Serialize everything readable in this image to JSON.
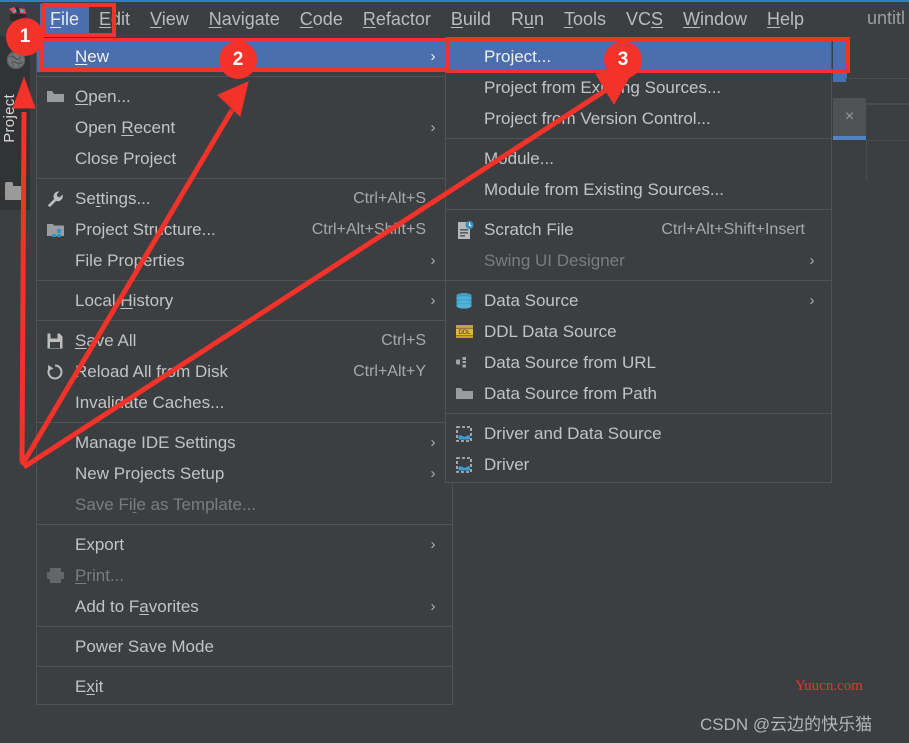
{
  "window": {
    "title": "untitl",
    "accent_color": "#2F7CC7",
    "menu_bg": "#3C3F41",
    "highlight_blue": "#4B6EAF",
    "annotation_red": "#F33229"
  },
  "menubar": {
    "logo_name": "intellij-idea-logo",
    "items": [
      {
        "label": "File",
        "mnemonic": "F",
        "active": true
      },
      {
        "label": "Edit",
        "mnemonic": "E",
        "active": false
      },
      {
        "label": "View",
        "mnemonic": "V",
        "active": false
      },
      {
        "label": "Navigate",
        "mnemonic": "N",
        "active": false
      },
      {
        "label": "Code",
        "mnemonic": "C",
        "active": false
      },
      {
        "label": "Refactor",
        "mnemonic": "R",
        "active": false
      },
      {
        "label": "Build",
        "mnemonic": "B",
        "active": false
      },
      {
        "label": "Run",
        "mnemonic": "u",
        "active": false
      },
      {
        "label": "Tools",
        "mnemonic": "T",
        "active": false
      },
      {
        "label": "VCS",
        "mnemonic": "S",
        "active": false
      },
      {
        "label": "Window",
        "mnemonic": "W",
        "active": false
      },
      {
        "label": "Help",
        "mnemonic": "H",
        "active": false
      }
    ]
  },
  "sidebar": {
    "globe_icon": "globe-icon",
    "project_tab_label": "Project",
    "folder_icon": "folder-icon"
  },
  "file_menu": {
    "items": [
      {
        "label": "New",
        "mnemonic": "N",
        "icon": null,
        "accel": "",
        "arrow": true,
        "selected": true,
        "disabled": false
      },
      {
        "type": "separator"
      },
      {
        "label": "Open...",
        "mnemonic": "O",
        "icon": "open-folder-icon",
        "accel": "",
        "arrow": false,
        "selected": false,
        "disabled": false
      },
      {
        "label": "Open Recent",
        "mnemonic": "R",
        "icon": null,
        "accel": "",
        "arrow": true,
        "selected": false,
        "disabled": false
      },
      {
        "label": "Close Project",
        "mnemonic": "",
        "icon": null,
        "accel": "",
        "arrow": false,
        "selected": false,
        "disabled": false
      },
      {
        "type": "separator"
      },
      {
        "label": "Settings...",
        "mnemonic": "t",
        "icon": "wrench-icon",
        "accel": "Ctrl+Alt+S",
        "arrow": false,
        "selected": false,
        "disabled": false
      },
      {
        "label": "Project Structure...",
        "mnemonic": "",
        "icon": "project-structure-icon",
        "accel": "Ctrl+Alt+Shift+S",
        "arrow": false,
        "selected": false,
        "disabled": false
      },
      {
        "label": "File Properties",
        "mnemonic": "",
        "icon": null,
        "accel": "",
        "arrow": true,
        "selected": false,
        "disabled": false
      },
      {
        "type": "separator"
      },
      {
        "label": "Local History",
        "mnemonic": "H",
        "icon": null,
        "accel": "",
        "arrow": true,
        "selected": false,
        "disabled": false
      },
      {
        "type": "separator"
      },
      {
        "label": "Save All",
        "mnemonic": "S",
        "icon": "save-icon",
        "accel": "Ctrl+S",
        "arrow": false,
        "selected": false,
        "disabled": false
      },
      {
        "label": "Reload All from Disk",
        "mnemonic": "",
        "icon": "reload-icon",
        "accel": "Ctrl+Alt+Y",
        "arrow": false,
        "selected": false,
        "disabled": false
      },
      {
        "label": "Invalidate Caches...",
        "mnemonic": "",
        "icon": null,
        "accel": "",
        "arrow": false,
        "selected": false,
        "disabled": false
      },
      {
        "type": "separator"
      },
      {
        "label": "Manage IDE Settings",
        "mnemonic": "",
        "icon": null,
        "accel": "",
        "arrow": true,
        "selected": false,
        "disabled": false
      },
      {
        "label": "New Projects Setup",
        "mnemonic": "",
        "icon": null,
        "accel": "",
        "arrow": true,
        "selected": false,
        "disabled": false
      },
      {
        "label": "Save File as Template...",
        "mnemonic": "l",
        "icon": null,
        "accel": "",
        "arrow": false,
        "selected": false,
        "disabled": true
      },
      {
        "type": "separator"
      },
      {
        "label": "Export",
        "mnemonic": "",
        "icon": null,
        "accel": "",
        "arrow": true,
        "selected": false,
        "disabled": false
      },
      {
        "label": "Print...",
        "mnemonic": "P",
        "icon": "printer-icon",
        "accel": "",
        "arrow": false,
        "selected": false,
        "disabled": true
      },
      {
        "label": "Add to Favorites",
        "mnemonic": "a",
        "icon": null,
        "accel": "",
        "arrow": true,
        "selected": false,
        "disabled": false
      },
      {
        "type": "separator"
      },
      {
        "label": "Power Save Mode",
        "mnemonic": "",
        "icon": null,
        "accel": "",
        "arrow": false,
        "selected": false,
        "disabled": false
      },
      {
        "type": "separator"
      },
      {
        "label": "Exit",
        "mnemonic": "x",
        "icon": null,
        "accel": "",
        "arrow": false,
        "selected": false,
        "disabled": false
      }
    ]
  },
  "new_submenu": {
    "items": [
      {
        "label": "Project...",
        "icon": null,
        "accel": "",
        "arrow": false,
        "selected": true,
        "disabled": false
      },
      {
        "label": "Project from Existing Sources...",
        "icon": null,
        "accel": "",
        "arrow": false,
        "selected": false,
        "disabled": false
      },
      {
        "label": "Project from Version Control...",
        "icon": null,
        "accel": "",
        "arrow": false,
        "selected": false,
        "disabled": false
      },
      {
        "type": "separator"
      },
      {
        "label": "Module...",
        "icon": null,
        "accel": "",
        "arrow": false,
        "selected": false,
        "disabled": false
      },
      {
        "label": "Module from Existing Sources...",
        "icon": null,
        "accel": "",
        "arrow": false,
        "selected": false,
        "disabled": false
      },
      {
        "type": "separator"
      },
      {
        "label": "Scratch File",
        "icon": "scratch-file-icon",
        "accel": "Ctrl+Alt+Shift+Insert",
        "arrow": false,
        "selected": false,
        "disabled": false
      },
      {
        "label": "Swing UI Designer",
        "icon": null,
        "accel": "",
        "arrow": true,
        "selected": false,
        "disabled": true
      },
      {
        "type": "separator"
      },
      {
        "label": "Data Source",
        "icon": "database-icon",
        "accel": "",
        "arrow": true,
        "selected": false,
        "disabled": false
      },
      {
        "label": "DDL Data Source",
        "icon": "ddl-icon",
        "accel": "",
        "arrow": false,
        "selected": false,
        "disabled": false
      },
      {
        "label": "Data Source from URL",
        "icon": "data-source-url-icon",
        "accel": "",
        "arrow": false,
        "selected": false,
        "disabled": false
      },
      {
        "label": "Data Source from Path",
        "icon": "open-folder-icon",
        "accel": "",
        "arrow": false,
        "selected": false,
        "disabled": false
      },
      {
        "type": "separator"
      },
      {
        "label": "Driver and Data Source",
        "icon": "driver-icon",
        "accel": "",
        "arrow": false,
        "selected": false,
        "disabled": false
      },
      {
        "label": "Driver",
        "icon": "driver-icon",
        "accel": "",
        "arrow": false,
        "selected": false,
        "disabled": false
      }
    ]
  },
  "editor": {
    "tab_close_glyph": "×"
  },
  "annotations": {
    "badges": [
      {
        "number": "1",
        "target": "File menu"
      },
      {
        "number": "2",
        "target": "New item"
      },
      {
        "number": "3",
        "target": "Project... item"
      }
    ]
  },
  "watermarks": {
    "red": "Yuucn.com",
    "csdn": "CSDN @云边的快乐猫"
  }
}
